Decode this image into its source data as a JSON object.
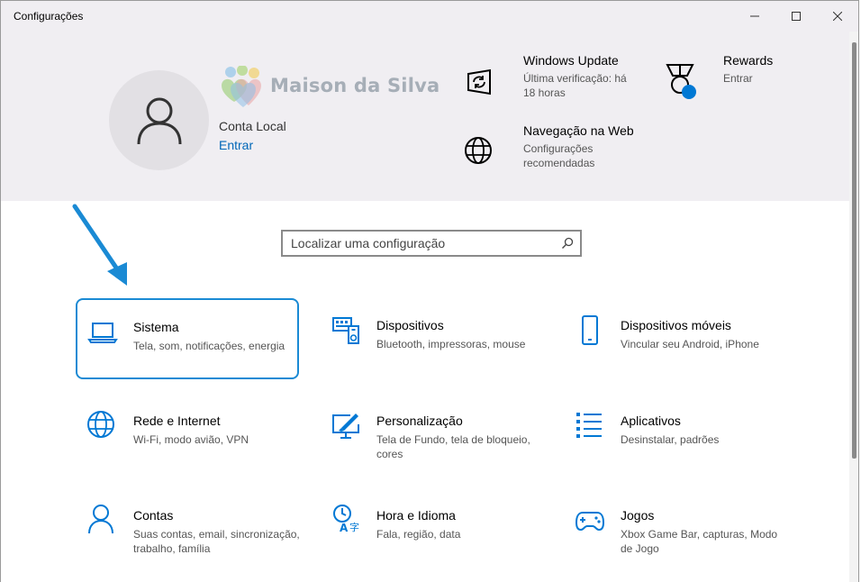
{
  "window": {
    "title": "Configurações"
  },
  "header": {
    "watermark": "Maison da Silva",
    "account": {
      "type": "Conta Local",
      "signin": "Entrar"
    },
    "items": [
      {
        "title": "Windows Update",
        "sub": "Última verificação: há 18 horas",
        "icon": "windows-update-icon"
      },
      {
        "title": "Rewards",
        "sub": "Entrar",
        "icon": "rewards-medal-icon"
      },
      {
        "title": "Navegação na Web",
        "sub": "Configurações recomendadas",
        "icon": "globe-icon"
      }
    ]
  },
  "search": {
    "placeholder": "Localizar uma configuração"
  },
  "tiles": [
    {
      "title": "Sistema",
      "desc": "Tela, som, notificações, energia",
      "icon": "laptop-icon",
      "selected": true
    },
    {
      "title": "Dispositivos",
      "desc": "Bluetooth, impressoras, mouse",
      "icon": "devices-icon"
    },
    {
      "title": "Dispositivos móveis",
      "desc": "Vincular seu Android, iPhone",
      "icon": "phone-icon"
    },
    {
      "title": "Rede e Internet",
      "desc": "Wi-Fi, modo avião, VPN",
      "icon": "globe-icon"
    },
    {
      "title": "Personalização",
      "desc": "Tela de Fundo, tela de bloqueio, cores",
      "icon": "personalization-icon"
    },
    {
      "title": "Aplicativos",
      "desc": "Desinstalar, padrões",
      "icon": "apps-list-icon"
    },
    {
      "title": "Contas",
      "desc": "Suas contas, email, sincronização, trabalho, família",
      "icon": "person-icon"
    },
    {
      "title": "Hora e Idioma",
      "desc": "Fala, região, data",
      "icon": "time-language-icon"
    },
    {
      "title": "Jogos",
      "desc": "Xbox Game Bar, capturas, Modo de Jogo",
      "icon": "gamepad-icon"
    }
  ],
  "colors": {
    "accent": "#0078d4",
    "link": "#0067b8",
    "header_bg": "#f0eef2",
    "selection_border": "#1a8ad4"
  }
}
